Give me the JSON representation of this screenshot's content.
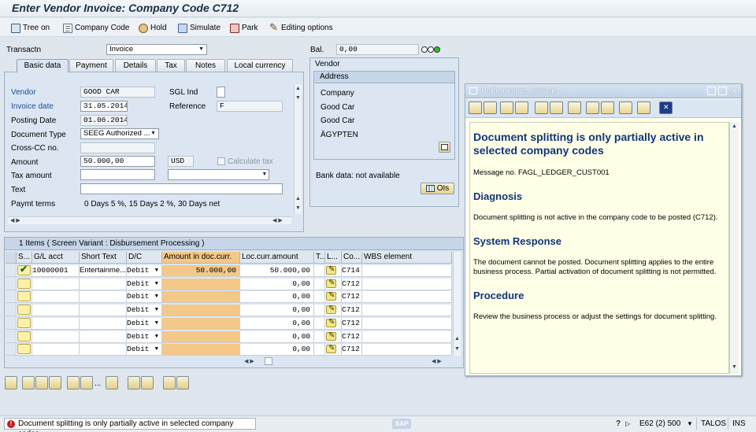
{
  "window_title": "Enter Vendor Invoice: Company Code C712",
  "toolbar": {
    "tree_on": "Tree on",
    "company_code": "Company Code",
    "hold": "Hold",
    "simulate": "Simulate",
    "park": "Park",
    "editing_options": "Editing options"
  },
  "header": {
    "transactn_label": "Transactn",
    "transactn_value": "Invoice",
    "bal_label": "Bal.",
    "bal_value": "0,00"
  },
  "tabs": [
    "Basic data",
    "Payment",
    "Details",
    "Tax",
    "Notes",
    "Local currency"
  ],
  "basic_data": {
    "vendor_label": "Vendor",
    "vendor_value": "GOOD CAR",
    "sgl_ind_label": "SGL Ind",
    "invoice_date_label": "Invoice date",
    "invoice_date_value": "31.05.2014",
    "reference_label": "Reference",
    "reference_value": "F",
    "posting_date_label": "Posting Date",
    "posting_date_value": "01.06.2014",
    "document_type_label": "Document Type",
    "document_type_value": "SEEG Authorized ...",
    "cross_cc_label": "Cross-CC no.",
    "amount_label": "Amount",
    "amount_value": "50.000,00",
    "currency_value": "USD",
    "calculate_tax_label": "Calculate tax",
    "tax_amount_label": "Tax amount",
    "text_label": "Text",
    "paymt_terms_label": "Paymt terms",
    "paymt_terms_value": "0 Days 5 %, 15 Days 2 %, 30 Days net"
  },
  "vendor_panel": {
    "title": "Vendor",
    "address_header": "Address",
    "address_lines": [
      "Company",
      "Good Car",
      "Good Car",
      "ÄGYPTEN"
    ],
    "bank_data": "Bank data: not available",
    "ois_button": "OIs"
  },
  "items_grid": {
    "caption": "1 Items ( Screen Variant : Disbursement Processing )",
    "columns": [
      "S...",
      "G/L acct",
      "Short Text",
      "D/C",
      "Amount in doc.curr.",
      "Loc.curr.amount",
      "T...",
      "L...",
      "Co...",
      "WBS element"
    ],
    "rows": [
      {
        "gl": "10000001",
        "short_text": "Entertainme...",
        "dc": "Debit",
        "amount": "50.000,00",
        "loc_amount": "50.000,00",
        "co": "C714"
      },
      {
        "gl": "",
        "short_text": "",
        "dc": "Debit",
        "amount": "",
        "loc_amount": "0,00",
        "co": "C712"
      },
      {
        "gl": "",
        "short_text": "",
        "dc": "Debit",
        "amount": "",
        "loc_amount": "0,00",
        "co": "C712"
      },
      {
        "gl": "",
        "short_text": "",
        "dc": "Debit",
        "amount": "",
        "loc_amount": "0,00",
        "co": "C712"
      },
      {
        "gl": "",
        "short_text": "",
        "dc": "Debit",
        "amount": "",
        "loc_amount": "0,00",
        "co": "C712"
      },
      {
        "gl": "",
        "short_text": "",
        "dc": "Debit",
        "amount": "",
        "loc_amount": "0,00",
        "co": "C712"
      },
      {
        "gl": "",
        "short_text": "",
        "dc": "Debit",
        "amount": "",
        "loc_amount": "0,00",
        "co": "C712"
      }
    ]
  },
  "performance_assistant": {
    "title": "Performance Assistant",
    "heading": "Document splitting is only partially active in selected company codes",
    "message_no": "Message no. FAGL_LEDGER_CUST001",
    "diagnosis_title": "Diagnosis",
    "diagnosis_text": "Document splitting is not active in the company code to be posted (C712).",
    "system_response_title": "System Response",
    "system_response_text": "The document cannot be posted. Document splitting applies to the entire business process. Partial activation of document splitting is not permitted.",
    "procedure_title": "Procedure",
    "procedure_text": "Review the business process or adjust the settings for document splitting."
  },
  "status_bar": {
    "message": "Document splitting is only partially active in selected company codes",
    "sap_logo": "SAP",
    "session": "E62 (2) 500",
    "server": "TALOS",
    "mode": "INS"
  }
}
